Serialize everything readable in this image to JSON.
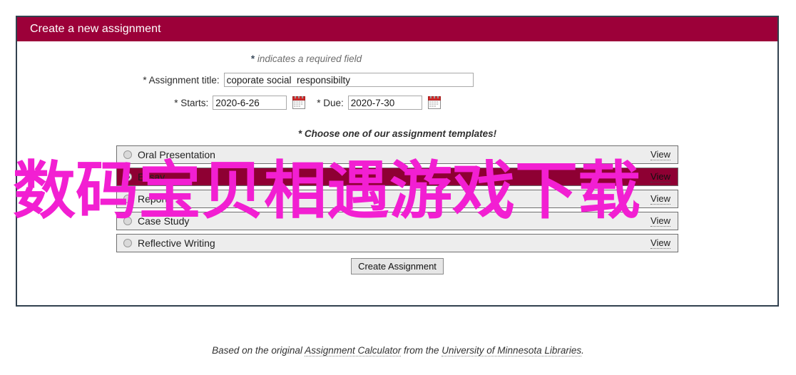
{
  "panel": {
    "header_title": "Create a new assignment",
    "required_note_star": "*",
    "required_note_text": " indicates a required field",
    "header_color": "#9c0039",
    "border_color": "#32414f"
  },
  "form": {
    "title_label": "* Assignment title:",
    "title_value": "coporate social  responsibilty",
    "title_placeholder": "",
    "starts_label": "* Starts:",
    "starts_value": "2020-6-26",
    "starts_placeholder": "",
    "due_label": "* Due:",
    "due_value": "2020-7-30",
    "due_placeholder": "",
    "starts_calendar_icon": "calendar-icon",
    "due_calendar_icon": "calendar-icon"
  },
  "templates": {
    "note": "* Choose one of our assignment templates!",
    "view_label": "View",
    "selected_index": 1,
    "items": [
      {
        "name": "Oral Presentation",
        "view": "View",
        "selected": false
      },
      {
        "name": "Essay",
        "view": "View",
        "selected": true
      },
      {
        "name": "Report",
        "view": "View",
        "selected": false
      },
      {
        "name": "Case Study",
        "view": "View",
        "selected": false
      },
      {
        "name": "Reflective Writing",
        "view": "View",
        "selected": false
      }
    ],
    "selected_row_color": "#8e0033",
    "row_color": "#ededed"
  },
  "actions": {
    "create_assignment_label": "Create Assignment"
  },
  "footer": {
    "prefix": "Based on the original ",
    "link1": "Assignment Calculator",
    "middle": " from the ",
    "link2": "University of Minnesota Libraries",
    "suffix": "."
  },
  "overlay": {
    "text": "数码宝贝相遇游戏下载",
    "color": "#f21fd2"
  }
}
